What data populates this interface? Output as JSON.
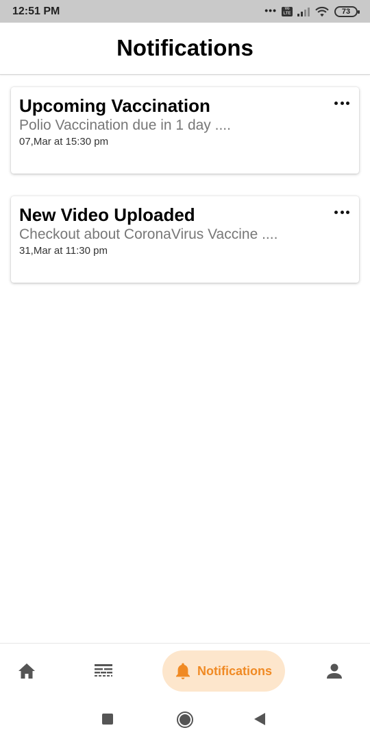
{
  "status_bar": {
    "time": "12:51 PM",
    "dots": "•••",
    "volte_label": "Vo LTE",
    "battery_level": "73",
    "icons": [
      "volte-icon",
      "signal-icon",
      "wifi-icon",
      "battery-icon"
    ]
  },
  "header": {
    "title": "Notifications"
  },
  "notifications": [
    {
      "title": "Upcoming Vaccination",
      "body": "Polio Vaccination due in 1 day ....",
      "time": "07,Mar at 15:30 pm"
    },
    {
      "title": "New Video Uploaded",
      "body": "Checkout about CoronaVirus Vaccine ....",
      "time": "31,Mar at 11:30 pm"
    }
  ],
  "bottom_nav": {
    "items": [
      {
        "icon": "home-icon",
        "label": ""
      },
      {
        "icon": "feed-icon",
        "label": ""
      },
      {
        "icon": "bell-icon",
        "label": "Notifications",
        "active": true
      },
      {
        "icon": "person-icon",
        "label": ""
      }
    ]
  },
  "colors": {
    "accent": "#f08a24",
    "accent_bg": "#fde6cc",
    "status_bar_bg": "#c9c9c9",
    "icon_gray": "#555555"
  },
  "system_nav": {
    "icons": [
      "recent-apps-icon",
      "home-circle-icon",
      "back-icon"
    ]
  }
}
